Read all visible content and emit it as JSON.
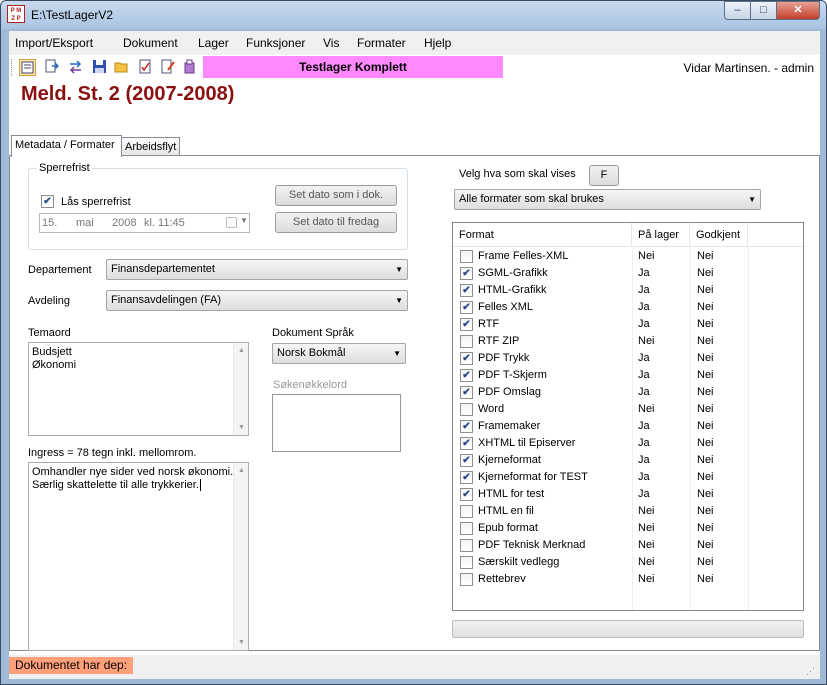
{
  "window": {
    "title": "E:\\TestLagerV2",
    "logo_text": "P M",
    "logo_text2": "Z P",
    "min": "–",
    "max": "□",
    "close": "✕"
  },
  "menu": [
    "Import/Eksport",
    "Dokument",
    "Lager",
    "Funksjoner",
    "Vis",
    "Formater",
    "Hjelp"
  ],
  "banner": "Testlager Komplett",
  "user": "Vidar Martinsen. - admin",
  "doc_title": "Meld. St. 2 (2007-2008)",
  "tabs": [
    "Metadata / Formater",
    "Arbeidsflyt"
  ],
  "sperrefrist": {
    "title": "Sperrefrist",
    "lock_label": "Lås sperrefrist",
    "lock_checked": true,
    "date_day": "15.",
    "date_month": "mai",
    "date_year": "2008",
    "date_time": "kl. 11:45",
    "btn_set_doc": "Set dato som i dok.",
    "btn_set_friday": "Set dato til fredag"
  },
  "departement": {
    "label": "Departement",
    "value": "Finansdepartementet"
  },
  "avdeling": {
    "label": "Avdeling",
    "value": "Finansavdelingen (FA)"
  },
  "temaord": {
    "label": "Temaord",
    "line1": "Budsjett",
    "line2": "Økonomi"
  },
  "dokument_sprak": {
    "label": "Dokument Språk",
    "value": "Norsk Bokmål"
  },
  "sokenokkelord": {
    "label": "Søkenøkkelord"
  },
  "ingress": {
    "label": "Ingress = 78 tegn inkl. mellomrom.",
    "line1": "Omhandler nye sider ved norsk økonomi.",
    "line2": "Særlig skattelette til alle trykkerier."
  },
  "format_select": {
    "label": "Velg hva som skal vises",
    "f_button": "F",
    "value": "Alle formater som skal brukes"
  },
  "grid": {
    "columns": [
      "Format",
      "På lager",
      "Godkjent"
    ],
    "rows": [
      {
        "checked": false,
        "format": "Frame Felles-XML",
        "lager": "Nei",
        "godkjent": "Nei"
      },
      {
        "checked": true,
        "format": "SGML-Grafikk",
        "lager": "Ja",
        "godkjent": "Nei"
      },
      {
        "checked": true,
        "format": "HTML-Grafikk",
        "lager": "Ja",
        "godkjent": "Nei"
      },
      {
        "checked": true,
        "format": "Felles XML",
        "lager": "Ja",
        "godkjent": "Nei"
      },
      {
        "checked": true,
        "format": "RTF",
        "lager": "Ja",
        "godkjent": "Nei"
      },
      {
        "checked": false,
        "format": "RTF ZIP",
        "lager": "Nei",
        "godkjent": "Nei"
      },
      {
        "checked": true,
        "format": "PDF Trykk",
        "lager": "Ja",
        "godkjent": "Nei"
      },
      {
        "checked": true,
        "format": "PDF T-Skjerm",
        "lager": "Ja",
        "godkjent": "Nei"
      },
      {
        "checked": true,
        "format": "PDF Omslag",
        "lager": "Ja",
        "godkjent": "Nei"
      },
      {
        "checked": false,
        "format": "Word",
        "lager": "Nei",
        "godkjent": "Nei"
      },
      {
        "checked": true,
        "format": "Framemaker",
        "lager": "Ja",
        "godkjent": "Nei"
      },
      {
        "checked": true,
        "format": "XHTML til Episerver",
        "lager": "Ja",
        "godkjent": "Nei"
      },
      {
        "checked": true,
        "format": "Kjerneformat",
        "lager": "Ja",
        "godkjent": "Nei"
      },
      {
        "checked": true,
        "format": "Kjerneformat for TEST",
        "lager": "Ja",
        "godkjent": "Nei"
      },
      {
        "checked": true,
        "format": "HTML for test",
        "lager": "Ja",
        "godkjent": "Nei"
      },
      {
        "checked": false,
        "format": "HTML en fil",
        "lager": "Nei",
        "godkjent": "Nei"
      },
      {
        "checked": false,
        "format": "Epub format",
        "lager": "Nei",
        "godkjent": "Nei"
      },
      {
        "checked": false,
        "format": "PDF Teknisk Merknad",
        "lager": "Nei",
        "godkjent": "Nei"
      },
      {
        "checked": false,
        "format": "Særskilt vedlegg",
        "lager": "Nei",
        "godkjent": "Nei"
      },
      {
        "checked": false,
        "format": "Rettebrev",
        "lager": "Nei",
        "godkjent": "Nei"
      }
    ]
  },
  "status": "Dokumentet har dep:",
  "icons": [
    "properties-icon",
    "next-icon",
    "transfer-icon",
    "save-icon",
    "open-folder-icon",
    "checklist-icon",
    "edit-icon",
    "export-icon"
  ]
}
